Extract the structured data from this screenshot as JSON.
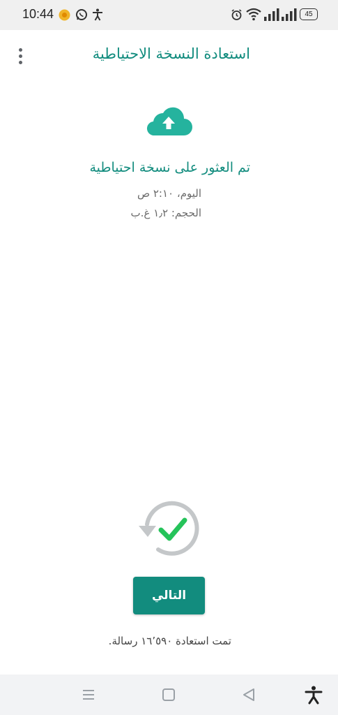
{
  "status_bar": {
    "time": "10:44",
    "battery": "45",
    "icons": [
      "notification-dot-icon",
      "whatsapp-icon",
      "accessibility-icon",
      "alarm-icon",
      "wifi-icon",
      "signal-icon",
      "signal-icon",
      "battery-icon"
    ]
  },
  "app_bar": {
    "title": "استعادة النسخة الاحتياطية",
    "menu_icon": "overflow-menu-icon"
  },
  "backup": {
    "icon": "cloud-upload-icon",
    "title": "تم العثور على نسخة احتياطية",
    "date_line": "اليوم، ٢:١٠ ص",
    "size_line": "الحجم: ١٫٢ غ.ب"
  },
  "restore": {
    "icon": "restore-complete-icon",
    "next_label": "التالي",
    "restored_text": "تمت استعادة ١٦٬٥٩٠ رسالة."
  },
  "nav_bar": {
    "icons": [
      "recents-icon",
      "home-icon",
      "back-icon",
      "accessibility-icon"
    ]
  },
  "colors": {
    "accent": "#128c7e",
    "cloud": "#25b39e",
    "check": "#25c35a",
    "ring": "#c4c7c9"
  }
}
